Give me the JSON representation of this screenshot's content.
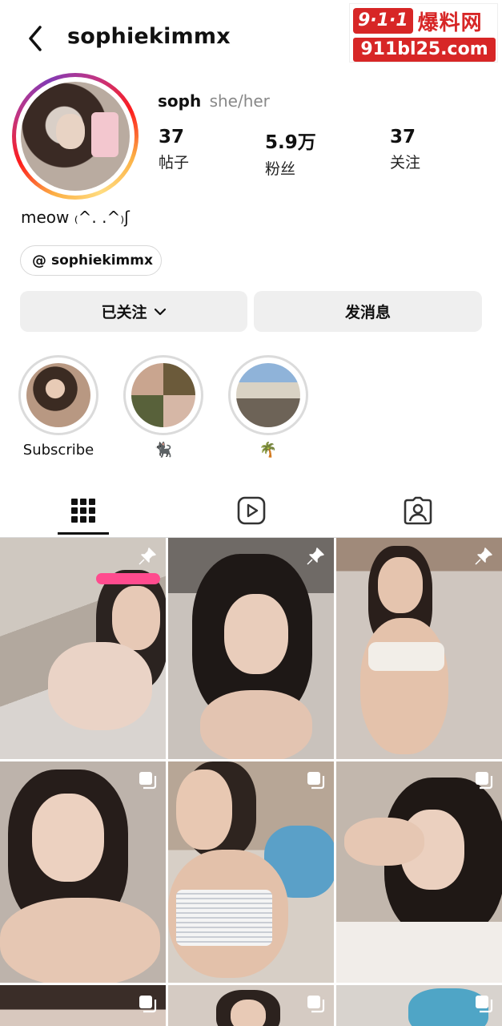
{
  "header": {
    "back_icon": "chevron-left-icon",
    "username": "sophiekimmx"
  },
  "watermark": {
    "badge": "9·1·1",
    "cn": "爆料网",
    "url": "911bl25.com"
  },
  "profile": {
    "name": "soph",
    "pronouns": "she/her",
    "stats": [
      {
        "value": "37",
        "label": "帖子"
      },
      {
        "value": "5.9万",
        "label": "粉丝"
      },
      {
        "value": "37",
        "label": "关注"
      }
    ],
    "bio": "meow ₍^. .^₎ʃ",
    "threads_handle": "sophiekimmx"
  },
  "actions": {
    "following_label": "已关注",
    "message_label": "发消息"
  },
  "highlights": [
    {
      "label": "Subscribe"
    },
    {
      "label": "🐈‍⬛"
    },
    {
      "label": "🌴"
    }
  ],
  "tabs": [
    "grid-icon",
    "reels-icon",
    "tagged-icon"
  ],
  "grid": {
    "rows": 3,
    "columns": 3,
    "tiles": [
      {
        "icon": "pin-icon"
      },
      {
        "icon": "pin-icon"
      },
      {
        "icon": "pin-icon"
      },
      {
        "icon": "carousel-icon"
      },
      {
        "icon": "carousel-icon"
      },
      {
        "icon": "carousel-icon"
      },
      {
        "icon": "carousel-icon"
      },
      {
        "icon": "carousel-icon"
      },
      {
        "icon": "carousel-icon"
      }
    ]
  }
}
